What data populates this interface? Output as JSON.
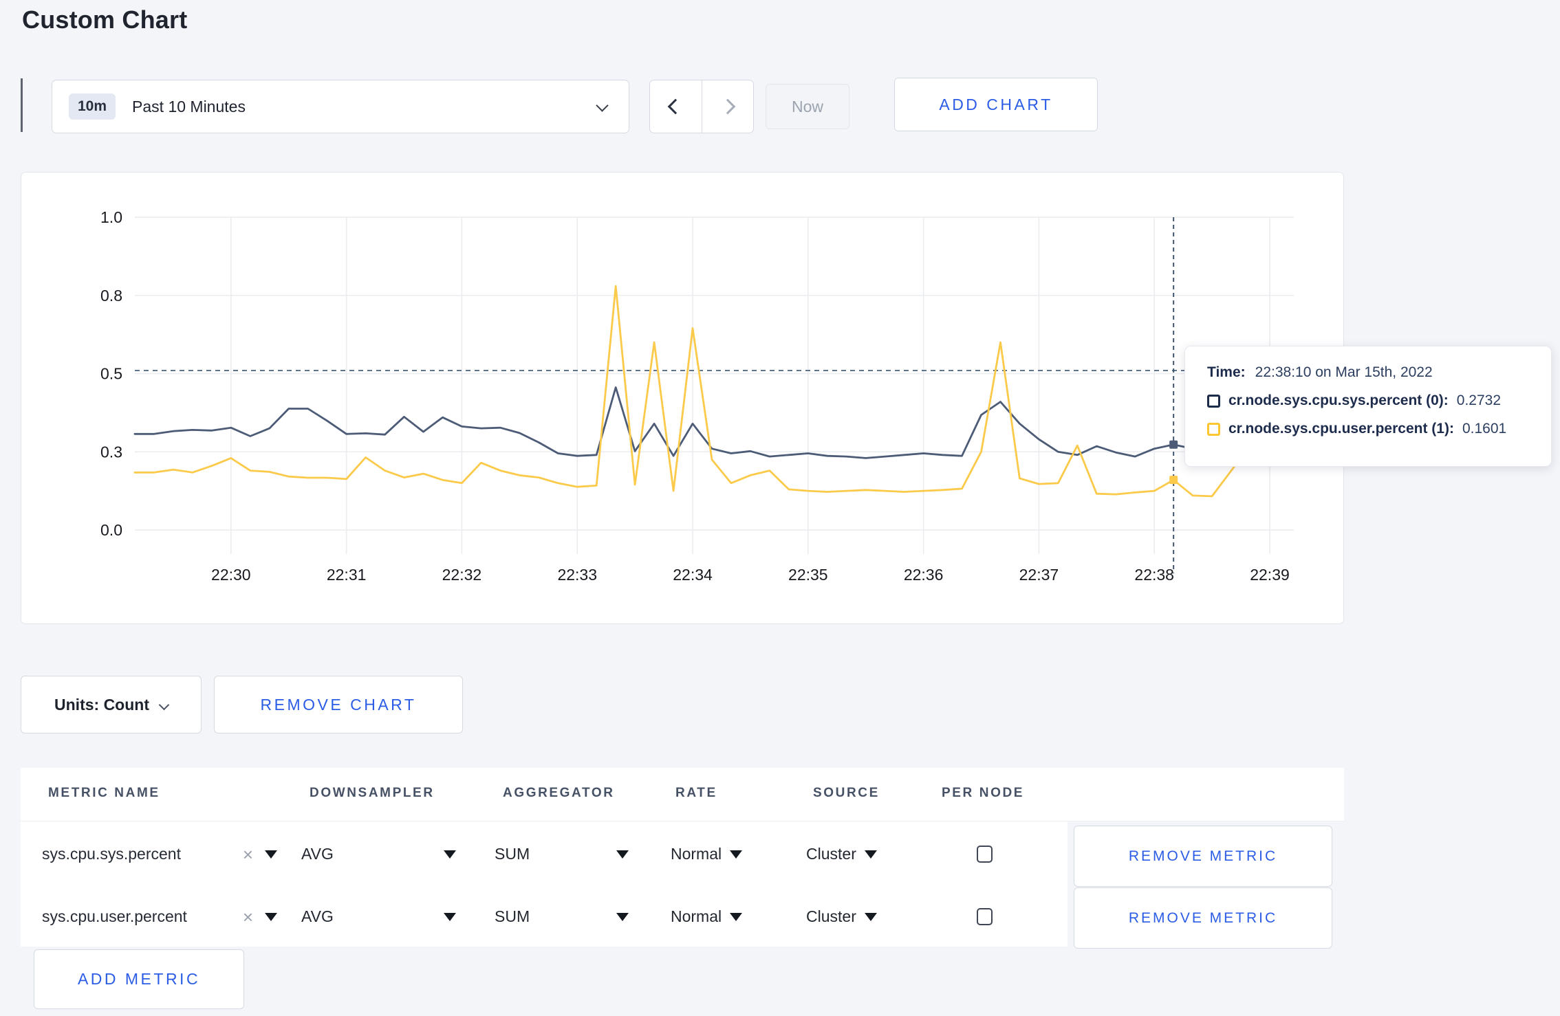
{
  "page": {
    "title": "Custom Chart"
  },
  "toolbar": {
    "range_badge": "10m",
    "range_label": "Past 10 Minutes",
    "now_label": "Now",
    "add_chart_label": "ADD CHART"
  },
  "chart_controls": {
    "units_label": "Units: Count",
    "remove_chart_label": "REMOVE CHART"
  },
  "tooltip": {
    "time_label": "Time:",
    "time_value": "22:38:10 on Mar 15th, 2022",
    "items": [
      {
        "label": "cr.node.sys.cpu.sys.percent (0):",
        "value": "0.2732",
        "swatch_color": "#1c2b4a"
      },
      {
        "label": "cr.node.sys.cpu.user.percent (1):",
        "value": "0.1601",
        "swatch_color": "#fec62e"
      }
    ]
  },
  "chart_data": {
    "type": "line",
    "x_start": "22:29:10",
    "x_step_seconds": 10,
    "x_ticks": [
      "22:30",
      "22:31",
      "22:32",
      "22:33",
      "22:34",
      "22:35",
      "22:36",
      "22:37",
      "22:38",
      "22:39"
    ],
    "y_ticks": [
      {
        "value": 0.0,
        "label": "0.0"
      },
      {
        "value": 0.25,
        "label": "0.3"
      },
      {
        "value": 0.5,
        "label": "0.5"
      },
      {
        "value": 0.75,
        "label": "0.8"
      },
      {
        "value": 1.0,
        "label": "1.0"
      }
    ],
    "ylim": [
      0,
      1
    ],
    "grid": true,
    "ref_line_value": 0.51,
    "crosshair_index": 54,
    "crosshair_time": "22:38:10",
    "series": [
      {
        "name": "cr.node.sys.cpu.sys.percent",
        "node": "(0)",
        "color": "#4c5b76",
        "values": [
          0.307,
          0.307,
          0.316,
          0.32,
          0.318,
          0.327,
          0.3,
          0.325,
          0.388,
          0.388,
          0.349,
          0.307,
          0.309,
          0.305,
          0.362,
          0.314,
          0.36,
          0.331,
          0.325,
          0.327,
          0.31,
          0.28,
          0.245,
          0.237,
          0.24,
          0.456,
          0.252,
          0.34,
          0.237,
          0.34,
          0.26,
          0.245,
          0.252,
          0.235,
          0.24,
          0.245,
          0.237,
          0.235,
          0.23,
          0.235,
          0.24,
          0.245,
          0.24,
          0.237,
          0.368,
          0.41,
          0.34,
          0.29,
          0.25,
          0.24,
          0.268,
          0.248,
          0.235,
          0.26,
          0.2732,
          0.26,
          0.25,
          0.255,
          0.26,
          0.255
        ]
      },
      {
        "name": "cr.node.sys.cpu.user.percent",
        "node": "(1)",
        "color": "#fbca4a",
        "values": [
          0.184,
          0.184,
          0.193,
          0.184,
          0.205,
          0.23,
          0.19,
          0.186,
          0.171,
          0.167,
          0.167,
          0.163,
          0.232,
          0.19,
          0.168,
          0.18,
          0.16,
          0.15,
          0.215,
          0.19,
          0.175,
          0.168,
          0.15,
          0.138,
          0.142,
          0.78,
          0.145,
          0.6,
          0.125,
          0.645,
          0.225,
          0.15,
          0.175,
          0.19,
          0.13,
          0.125,
          0.122,
          0.125,
          0.128,
          0.125,
          0.122,
          0.125,
          0.128,
          0.132,
          0.25,
          0.6,
          0.165,
          0.147,
          0.15,
          0.27,
          0.116,
          0.114,
          0.12,
          0.125,
          0.1601,
          0.11,
          0.108,
          0.19,
          0.27,
          0.22
        ]
      }
    ]
  },
  "metrics_table": {
    "headers": [
      "METRIC NAME",
      "DOWNSAMPLER",
      "AGGREGATOR",
      "RATE",
      "SOURCE",
      "PER NODE"
    ],
    "rows": [
      {
        "metric": "sys.cpu.sys.percent",
        "downsampler": "AVG",
        "aggregator": "SUM",
        "rate": "Normal",
        "source": "Cluster",
        "per_node_checked": false,
        "remove_label": "REMOVE METRIC"
      },
      {
        "metric": "sys.cpu.user.percent",
        "downsampler": "AVG",
        "aggregator": "SUM",
        "rate": "Normal",
        "source": "Cluster",
        "per_node_checked": false,
        "remove_label": "REMOVE METRIC"
      }
    ],
    "add_metric_label": "ADD METRIC"
  }
}
